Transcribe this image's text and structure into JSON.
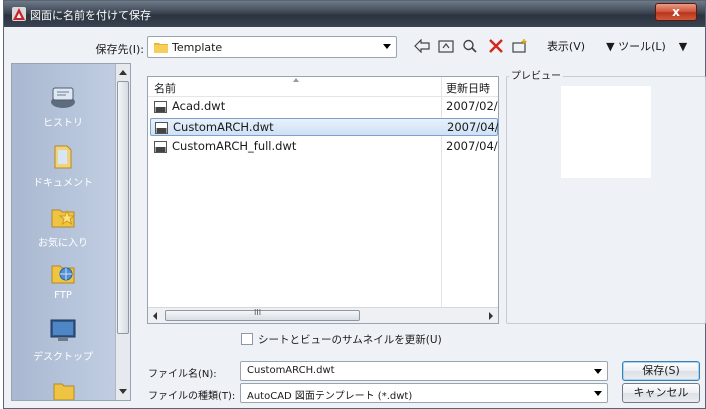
{
  "title": "図面に名前を付けて保存",
  "close_label": "x",
  "save_in": {
    "label": "保存先(I):",
    "value": "Template"
  },
  "toolbar": {
    "view_label": "表示(V)",
    "tools_label": "ツール(L)"
  },
  "places": [
    {
      "label": "ヒストリ",
      "icon": "history-icon"
    },
    {
      "label": "ドキュメント",
      "icon": "documents-icon"
    },
    {
      "label": "お気に入り",
      "icon": "favorites-icon"
    },
    {
      "label": "FTP",
      "icon": "ftp-icon"
    },
    {
      "label": "デスクトップ",
      "icon": "desktop-icon"
    }
  ],
  "file_list": {
    "columns": [
      "名前",
      "更新日時"
    ],
    "rows": [
      {
        "name": "Acad.dwt",
        "date": "2007/02/",
        "selected": false
      },
      {
        "name": "CustomARCH.dwt",
        "date": "2007/04/",
        "selected": true
      },
      {
        "name": "CustomARCH_full.dwt",
        "date": "2007/04/",
        "selected": false
      }
    ],
    "scroll_mark": "III"
  },
  "preview": {
    "label": "プレビュー"
  },
  "thumbnail_checkbox": {
    "label": "シートとビューのサムネイルを更新(U)",
    "checked": false
  },
  "filename": {
    "label": "ファイル名(N):",
    "value": "CustomARCH.dwt"
  },
  "filetype": {
    "label": "ファイルの種類(T):",
    "value": "AutoCAD 図面テンプレート (*.dwt)"
  },
  "buttons": {
    "save": "保存(S)",
    "cancel": "キャンセル"
  },
  "colors": {
    "accent": "#3c7fb1",
    "selection": "#cfe1f6",
    "close": "#c8472b"
  }
}
